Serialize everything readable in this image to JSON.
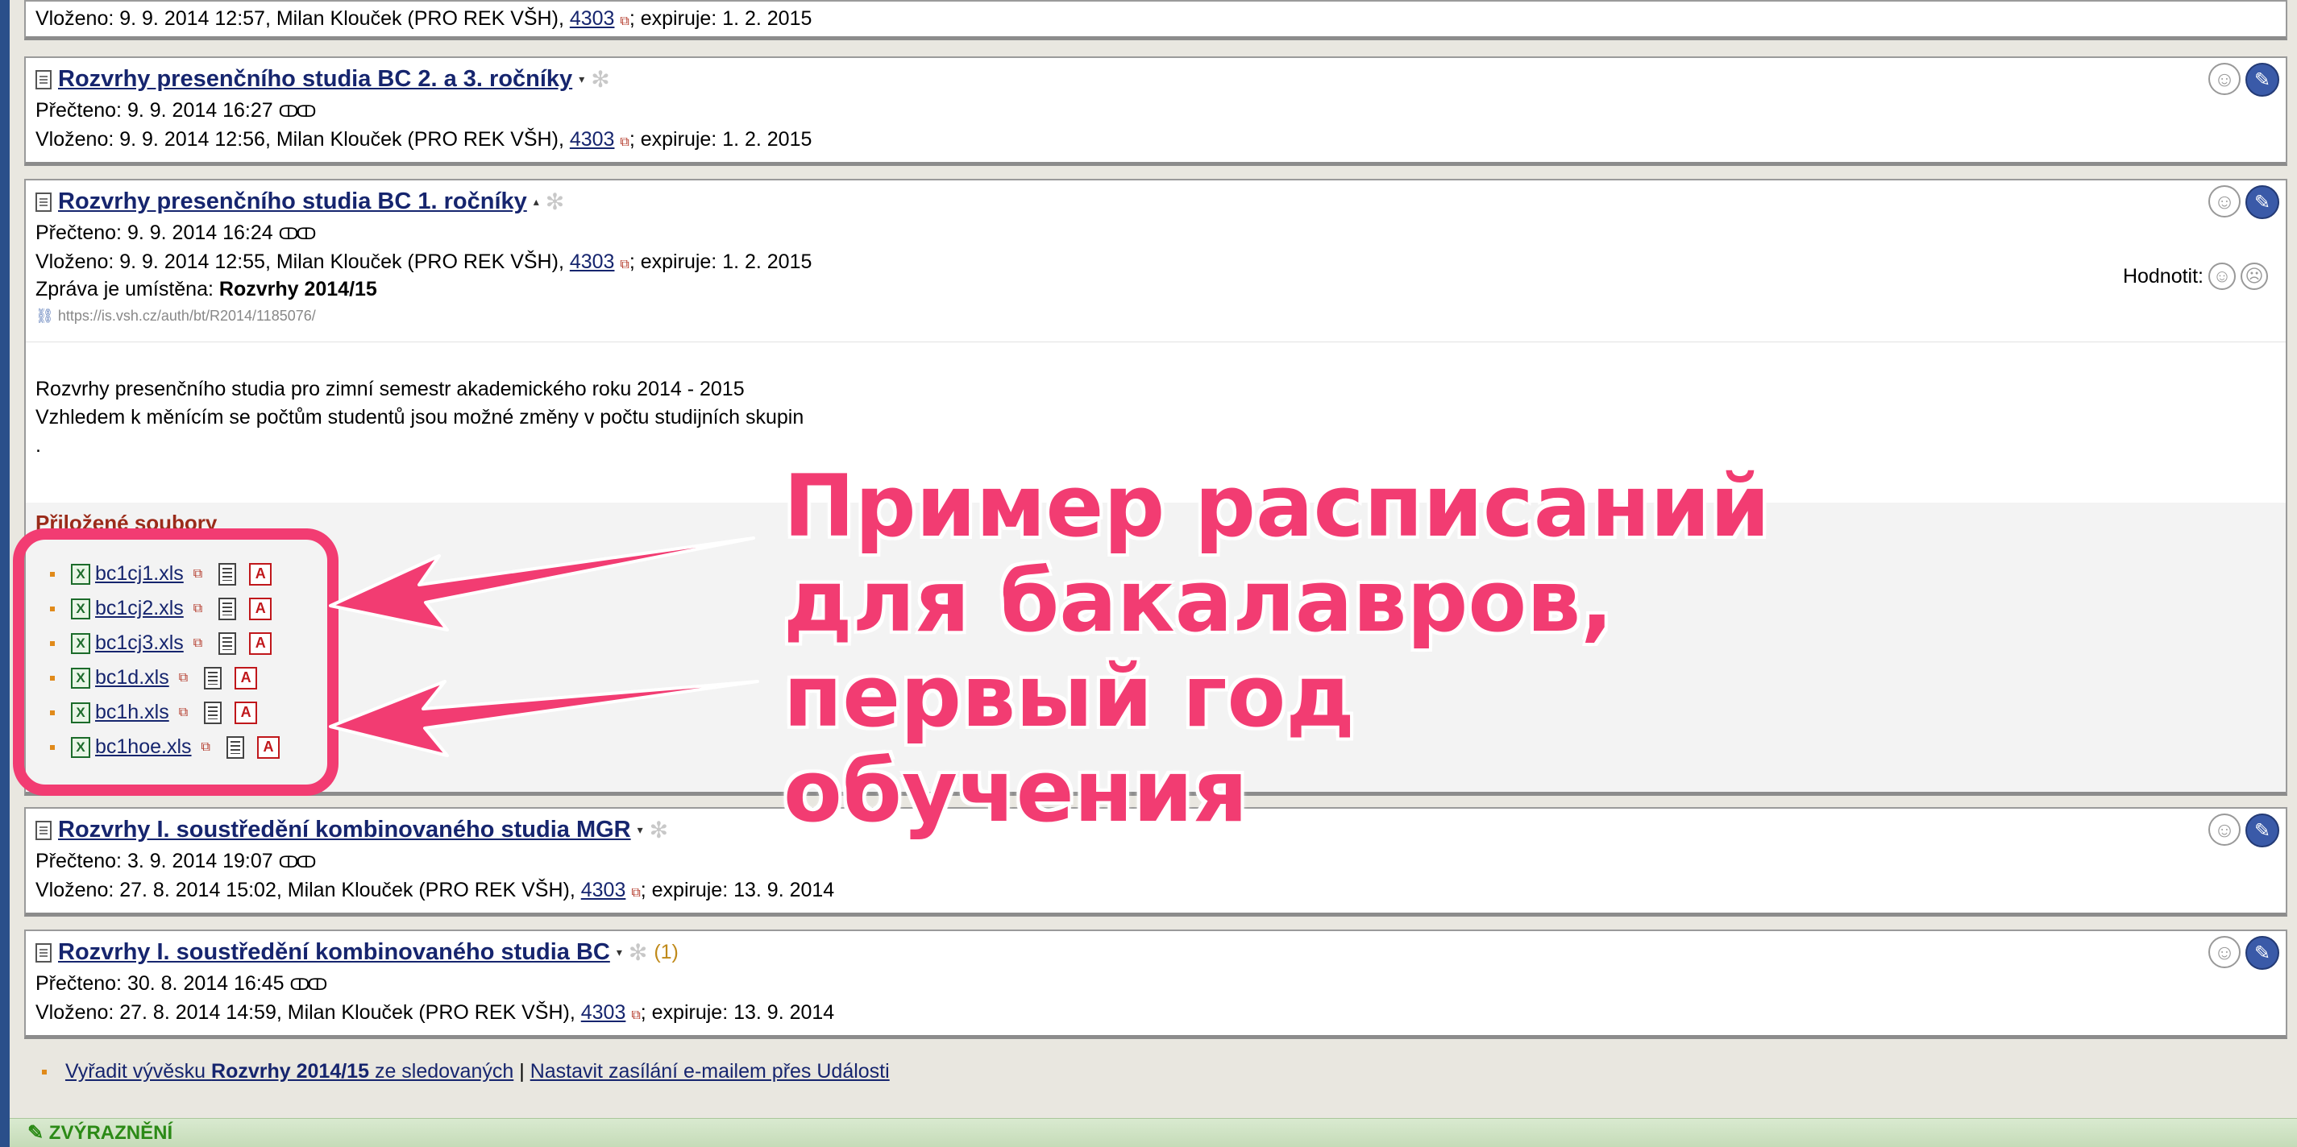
{
  "top_partial": {
    "posted_label": "Vloženo: 9. 9. 2014 12:57, Milan Klouček (PRO REK VŠH),",
    "user_id": "4303",
    "expire": "; expiruje: 1. 2. 2015"
  },
  "messages": [
    {
      "title": "Rozvrhy presenčního studia BC 2. a 3. ročníky",
      "read": "Přečteno: 9. 9. 2014 16:27",
      "posted_label": "Vloženo: 9. 9. 2014 12:56, Milan Klouček (PRO REK VŠH),",
      "user_id": "4303",
      "expire": "; expiruje: 1. 2. 2015"
    },
    {
      "title": "Rozvrhy presenčního studia BC 1. ročníky",
      "read": "Přečteno: 9. 9. 2014 16:24",
      "posted_label": "Vloženo: 9. 9. 2014 12:55, Milan Klouček (PRO REK VŠH),",
      "user_id": "4303",
      "expire": "; expiruje: 1. 2. 2015",
      "placed_label": "Zpráva je umístěna:",
      "placed_value": "Rozvrhy 2014/15",
      "url": "https://is.vsh.cz/auth/bt/R2014/1185076/",
      "rate_label": "Hodnotit:",
      "body_line1": "Rozvrhy presenčního studia pro zimní semestr akademického roku 2014 - 2015",
      "body_line2": "Vzhledem k měnícím se počtům studentů jsou možné změny v počtu studijních skupin .",
      "attachments_title": "Přiložené soubory",
      "files": [
        "bc1cj1.xls",
        "bc1cj2.xls",
        "bc1cj3.xls",
        "bc1d.xls",
        "bc1h.xls",
        "bc1hoe.xls"
      ]
    },
    {
      "title": "Rozvrhy I. soustředění kombinovaného studia MGR",
      "read": "Přečteno: 3. 9. 2014 19:07",
      "posted_label": "Vloženo: 27. 8. 2014 15:02, Milan Klouček (PRO REK VŠH),",
      "user_id": "4303",
      "expire": "; expiruje: 13. 9. 2014"
    },
    {
      "title": "Rozvrhy I. soustředění kombinovaného studia BC",
      "count": "(1)",
      "read": "Přečteno: 30. 8. 2014 16:45",
      "posted_label": "Vloženo: 27. 8. 2014 14:59, Milan Klouček (PRO REK VŠH),",
      "user_id": "4303",
      "expire": "; expiruje: 13. 9. 2014"
    }
  ],
  "annotation": {
    "line1": "Пример расписаний",
    "line2": "для бакалавров,",
    "line3": "первый год обучения",
    "color": "#f23c72"
  },
  "footer": {
    "unfollow_prefix": "Vyřadit vývěsku ",
    "unfollow_bold": "Rozvrhy 2014/15",
    "unfollow_suffix": " ze sledovaných",
    "divider": "|",
    "email_link": "Nastavit zasílání e-mailem přes Události"
  },
  "bottom_bar": {
    "label": "ZVÝRAZNĚNÍ"
  },
  "icons": {
    "smiley": "☺",
    "frown": "☹",
    "edit": "✎",
    "gear": "✻",
    "glasses": "ↀↀ",
    "dropdown": "▾",
    "dropup": "▴",
    "popup": "⧉",
    "xls": "X",
    "pdf": "A"
  }
}
